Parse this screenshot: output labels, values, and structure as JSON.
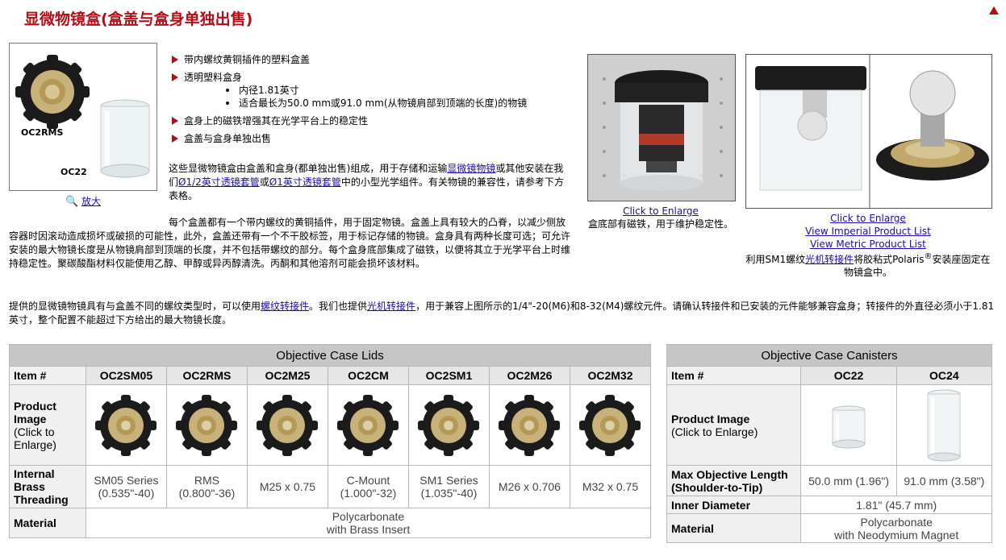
{
  "page": {
    "title": "显微物镜盒(盒盖与盒身单独出售)"
  },
  "product_box": {
    "label_lid": "OC2RMS",
    "label_can": "OC22",
    "enlarge": "放大"
  },
  "bullets": [
    "带内螺纹黄铜插件的塑料盒盖",
    "透明塑料盒身",
    "盒身上的磁铁增强其在光学平台上的稳定性",
    "盒盖与盒身单独出售"
  ],
  "subbullets": [
    "内径1.81英寸",
    "适合最长为50.0 mm或91.0 mm(从物镜肩部到顶端的长度)的物镜"
  ],
  "para1": {
    "t1": "这些显微物镜盒由盒盖和盒身(都单独出售)组成，用于存储和运输",
    "l1": "显微镜物镜",
    "t2": "或其他安装在我们",
    "l2": "Ø1/2英寸透镜套管",
    "t3": "或",
    "l3": "Ø1英寸透镜套管",
    "t4": "中的小型光学组件。有关物镜的兼容性，请参考下方表格。"
  },
  "para2": "每个盒盖都有一个带内螺纹的黄铜插件，用于固定物镜。盒盖上具有较大的凸脊，以减少侧放容器时因滚动造成损坏或破损的可能性，此外，盒盖还带有一个不干胶标签，用于标记存储的物镜。盒身具有两种长度可选；可允许安装的最大物镜长度是从物镜肩部到顶端的长度，并不包括带螺纹的部分。每个盒身底部集成了磁铁，以便将其立于光学平台上时维持稳定性。聚碳酸酯材料仅能使用乙醇、甲醇或异丙醇清洗。丙酮和其他溶剂可能会损坏该材料。",
  "para3": {
    "t1": "提供的显微镜物镜具有与盒盖不同的螺纹类型时，可以使用",
    "l1": "螺纹转接件",
    "t2": "。我们也提供",
    "l2": "光机转接件",
    "t3": "，用于兼容上图所示的1/4\"-20(M6)和8-32(M4)螺纹元件。请确认转接件和已安装的元件能够兼容盒身；转接件的外直径必须小于1.81英寸，整个配置不能超过下方给出的最大物镜长度。"
  },
  "photo1": {
    "link": "Click to Enlarge",
    "caption": "盒底部有磁铁，用于维护稳定性。"
  },
  "photo2": {
    "link": "Click to Enlarge",
    "imperial": "View Imperial Product List",
    "metric": "View Metric Product List",
    "cap_a": "利用SM1螺纹",
    "cap_link": "光机转接件",
    "cap_b": "将胶粘式Polaris",
    "cap_sup": "®",
    "cap_c": "安装座固定在物镜盒中。"
  },
  "lids_table": {
    "title": "Objective Case Lids",
    "item_label": "Item #",
    "items": [
      "OC2SM05",
      "OC2RMS",
      "OC2M25",
      "OC2CM",
      "OC2SM1",
      "OC2M26",
      "OC2M32"
    ],
    "image_label": "Product Image",
    "image_hint": "(Click to Enlarge)",
    "thread_label": "Internal Brass Threading",
    "threads": [
      "SM05 Series (0.535\"-40)",
      "RMS (0.800\"-36)",
      "M25 x 0.75",
      "C-Mount (1.000\"-32)",
      "SM1 Series (1.035\"-40)",
      "M26 x 0.706",
      "M32 x 0.75"
    ],
    "material_label": "Material",
    "material_1": "Polycarbonate",
    "material_2": "with Brass Insert"
  },
  "canisters_table": {
    "title": "Objective Case Canisters",
    "item_label": "Item #",
    "items": [
      "OC22",
      "OC24"
    ],
    "image_label": "Product Image",
    "image_hint": "(Click to Enlarge)",
    "length_label": "Max Objective Length (Shoulder-to-Tip)",
    "lengths": [
      "50.0 mm (1.96\")",
      "91.0 mm (3.58\")"
    ],
    "diameter_label": "Inner Diameter",
    "diameter": "1.81\" (45.7 mm)",
    "material_label": "Material",
    "material_1": "Polycarbonate",
    "material_2": "with Neodymium Magnet"
  },
  "colors": {
    "accent": "#b50d16",
    "link": "#1a0dab",
    "header": "#c6c6c6"
  }
}
